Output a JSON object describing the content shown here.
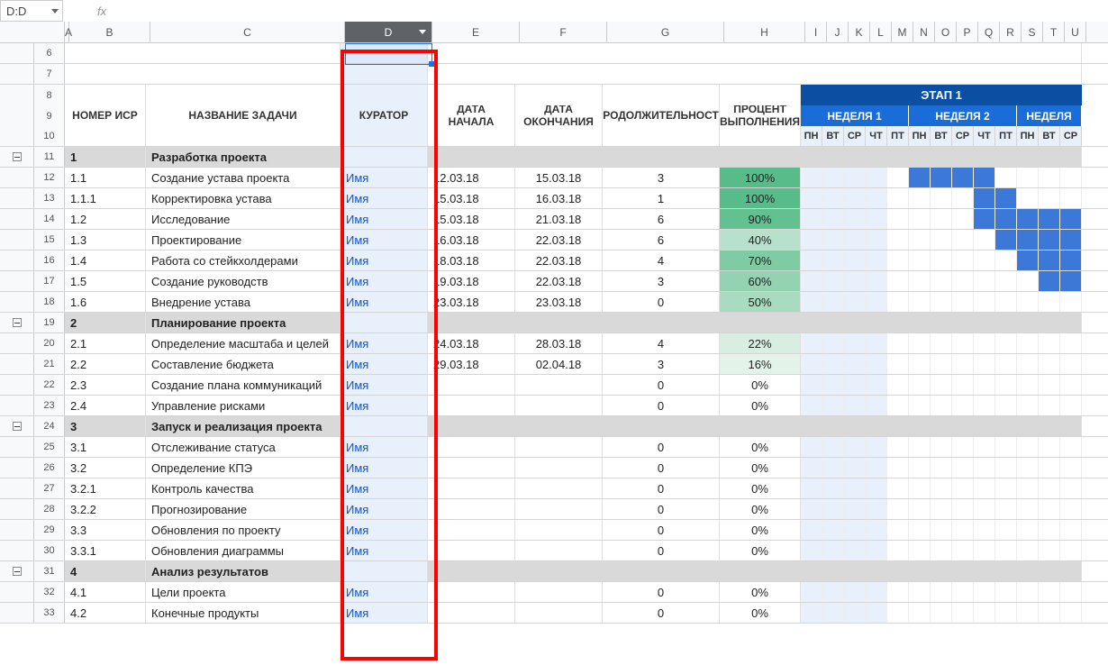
{
  "namebox": "D:D",
  "fx": "fx",
  "cols": [
    "A",
    "B",
    "C",
    "D",
    "E",
    "F",
    "G",
    "H",
    "I",
    "J",
    "K",
    "L",
    "M",
    "N",
    "O",
    "P",
    "Q",
    "R",
    "S",
    "T",
    "U"
  ],
  "headers": {
    "wbs": "НОМЕР ИСР",
    "task": "НАЗВАНИЕ ЗАДАЧИ",
    "owner": "КУРАТОР",
    "start": "ДАТА НАЧАЛА",
    "end": "ДАТА ОКОНЧАНИЯ",
    "dur": "ПРОДОЛЖИТЕЛЬНОСТЬ",
    "pct": "ПРОЦЕНТ ВЫПОЛНЕНИЯ",
    "phase": "ЭТАП 1",
    "week1": "НЕДЕЛЯ 1",
    "week2": "НЕДЕЛЯ 2",
    "week3": "НЕДЕЛЯ"
  },
  "days": [
    "ПН",
    "ВТ",
    "СР",
    "ЧТ",
    "ПТ",
    "ПН",
    "ВТ",
    "СР",
    "ЧТ",
    "ПТ",
    "ПН",
    "ВТ",
    "СР"
  ],
  "rows": [
    {
      "n": 6,
      "type": "blank"
    },
    {
      "n": 7,
      "type": "blank"
    },
    {
      "n": 8,
      "type": "hdr1"
    },
    {
      "n": 9,
      "type": "hdr2"
    },
    {
      "n": 10,
      "type": "hdr3"
    },
    {
      "n": 11,
      "type": "sect",
      "collapse": true,
      "wbs": "1",
      "task": "Разработка проекта"
    },
    {
      "n": 12,
      "type": "task",
      "wbs": "1.1",
      "task": "Создание устава проекта",
      "owner": "Имя",
      "start": "12.03.18",
      "end": "15.03.18",
      "dur": "3",
      "pct": "100%",
      "pcolor": "#57bb8a",
      "g": [
        5,
        6,
        7,
        8
      ],
      "f": [
        0,
        1,
        2,
        3
      ]
    },
    {
      "n": 13,
      "type": "task",
      "wbs": "1.1.1",
      "task": "Корректировка устава",
      "owner": "Имя",
      "start": "15.03.18",
      "end": "16.03.18",
      "dur": "1",
      "pct": "100%",
      "pcolor": "#57bb8a",
      "g": [
        8,
        9
      ],
      "f": [
        0,
        1,
        2,
        3
      ]
    },
    {
      "n": 14,
      "type": "task",
      "wbs": "1.2",
      "task": "Исследование",
      "owner": "Имя",
      "start": "15.03.18",
      "end": "21.03.18",
      "dur": "6",
      "pct": "90%",
      "pcolor": "#63c091",
      "g": [
        8,
        9,
        10,
        11,
        12
      ],
      "f": [
        0,
        1,
        2,
        3
      ]
    },
    {
      "n": 15,
      "type": "task",
      "wbs": "1.3",
      "task": "Проектирование",
      "owner": "Имя",
      "start": "16.03.18",
      "end": "22.03.18",
      "dur": "6",
      "pct": "40%",
      "pcolor": "#b7e1cb",
      "g": [
        9,
        10,
        11,
        12
      ],
      "f": [
        0,
        1,
        2,
        3
      ]
    },
    {
      "n": 16,
      "type": "task",
      "wbs": "1.4",
      "task": "Работа со стейкхолдерами",
      "owner": "Имя",
      "start": "18.03.18",
      "end": "22.03.18",
      "dur": "4",
      "pct": "70%",
      "pcolor": "#7fcba4",
      "g": [
        10,
        11,
        12
      ],
      "f": [
        0,
        1,
        2,
        3
      ]
    },
    {
      "n": 17,
      "type": "task",
      "wbs": "1.5",
      "task": "Создание руководств",
      "owner": "Имя",
      "start": "19.03.18",
      "end": "22.03.18",
      "dur": "3",
      "pct": "60%",
      "pcolor": "#93d3b2",
      "g": [
        11,
        12
      ],
      "f": [
        0,
        1,
        2,
        3
      ]
    },
    {
      "n": 18,
      "type": "task",
      "wbs": "1.6",
      "task": "Внедрение устава",
      "owner": "Имя",
      "start": "23.03.18",
      "end": "23.03.18",
      "dur": "0",
      "pct": "50%",
      "pcolor": "#a8dbbf",
      "g": [],
      "f": [
        0,
        1,
        2,
        3
      ]
    },
    {
      "n": 19,
      "type": "sect",
      "collapse": true,
      "wbs": "2",
      "task": "Планирование проекта"
    },
    {
      "n": 20,
      "type": "task",
      "wbs": "2.1",
      "task": "Определение масштаба и целей",
      "owner": "Имя",
      "start": "24.03.18",
      "end": "28.03.18",
      "dur": "4",
      "pct": "22%",
      "pcolor": "#d9eee3",
      "g": [],
      "f": [
        0,
        1,
        2,
        3
      ]
    },
    {
      "n": 21,
      "type": "task",
      "wbs": "2.2",
      "task": "Составление бюджета",
      "owner": "Имя",
      "start": "29.03.18",
      "end": "02.04.18",
      "dur": "3",
      "pct": "16%",
      "pcolor": "#e4f3ea",
      "g": [],
      "f": [
        0,
        1,
        2,
        3
      ]
    },
    {
      "n": 22,
      "type": "task",
      "wbs": "2.3",
      "task": "Создание плана коммуникаций",
      "owner": "Имя",
      "start": "",
      "end": "",
      "dur": "0",
      "pct": "0%",
      "pcolor": "",
      "g": [],
      "f": [
        0,
        1,
        2,
        3
      ]
    },
    {
      "n": 23,
      "type": "task",
      "wbs": "2.4",
      "task": "Управление рисками",
      "owner": "Имя",
      "start": "",
      "end": "",
      "dur": "0",
      "pct": "0%",
      "pcolor": "",
      "g": [],
      "f": [
        0,
        1,
        2,
        3
      ]
    },
    {
      "n": 24,
      "type": "sect",
      "collapse": true,
      "wbs": "3",
      "task": "Запуск и реализация проекта"
    },
    {
      "n": 25,
      "type": "task",
      "wbs": "3.1",
      "task": "Отслеживание статуса",
      "owner": "Имя",
      "start": "",
      "end": "",
      "dur": "0",
      "pct": "0%",
      "pcolor": "",
      "g": [],
      "f": [
        0,
        1,
        2,
        3
      ]
    },
    {
      "n": 26,
      "type": "task",
      "wbs": "3.2",
      "task": "Определение КПЭ",
      "owner": "Имя",
      "start": "",
      "end": "",
      "dur": "0",
      "pct": "0%",
      "pcolor": "",
      "g": [],
      "f": [
        0,
        1,
        2,
        3
      ]
    },
    {
      "n": 27,
      "type": "task",
      "wbs": "3.2.1",
      "task": "Контроль качества",
      "owner": "Имя",
      "start": "",
      "end": "",
      "dur": "0",
      "pct": "0%",
      "pcolor": "",
      "g": [],
      "f": [
        0,
        1,
        2,
        3
      ]
    },
    {
      "n": 28,
      "type": "task",
      "wbs": "3.2.2",
      "task": "Прогнозирование",
      "owner": "Имя",
      "start": "",
      "end": "",
      "dur": "0",
      "pct": "0%",
      "pcolor": "",
      "g": [],
      "f": [
        0,
        1,
        2,
        3
      ]
    },
    {
      "n": 29,
      "type": "task",
      "wbs": "3.3",
      "task": "Обновления по проекту",
      "owner": "Имя",
      "start": "",
      "end": "",
      "dur": "0",
      "pct": "0%",
      "pcolor": "",
      "g": [],
      "f": [
        0,
        1,
        2,
        3
      ]
    },
    {
      "n": 30,
      "type": "task",
      "wbs": "3.3.1",
      "task": "Обновления диаграммы",
      "owner": "Имя",
      "start": "",
      "end": "",
      "dur": "0",
      "pct": "0%",
      "pcolor": "",
      "g": [],
      "f": [
        0,
        1,
        2,
        3
      ]
    },
    {
      "n": 31,
      "type": "sect",
      "collapse": true,
      "wbs": "4",
      "task": "Анализ результатов"
    },
    {
      "n": 32,
      "type": "task",
      "wbs": "4.1",
      "task": "Цели проекта",
      "owner": "Имя",
      "start": "",
      "end": "",
      "dur": "0",
      "pct": "0%",
      "pcolor": "",
      "g": [],
      "f": [
        0,
        1,
        2,
        3
      ]
    },
    {
      "n": 33,
      "type": "task",
      "wbs": "4.2",
      "task": "Конечные продукты",
      "owner": "Имя",
      "start": "",
      "end": "",
      "dur": "0",
      "pct": "0%",
      "pcolor": "",
      "g": [],
      "f": [
        0,
        1,
        2,
        3
      ]
    }
  ]
}
